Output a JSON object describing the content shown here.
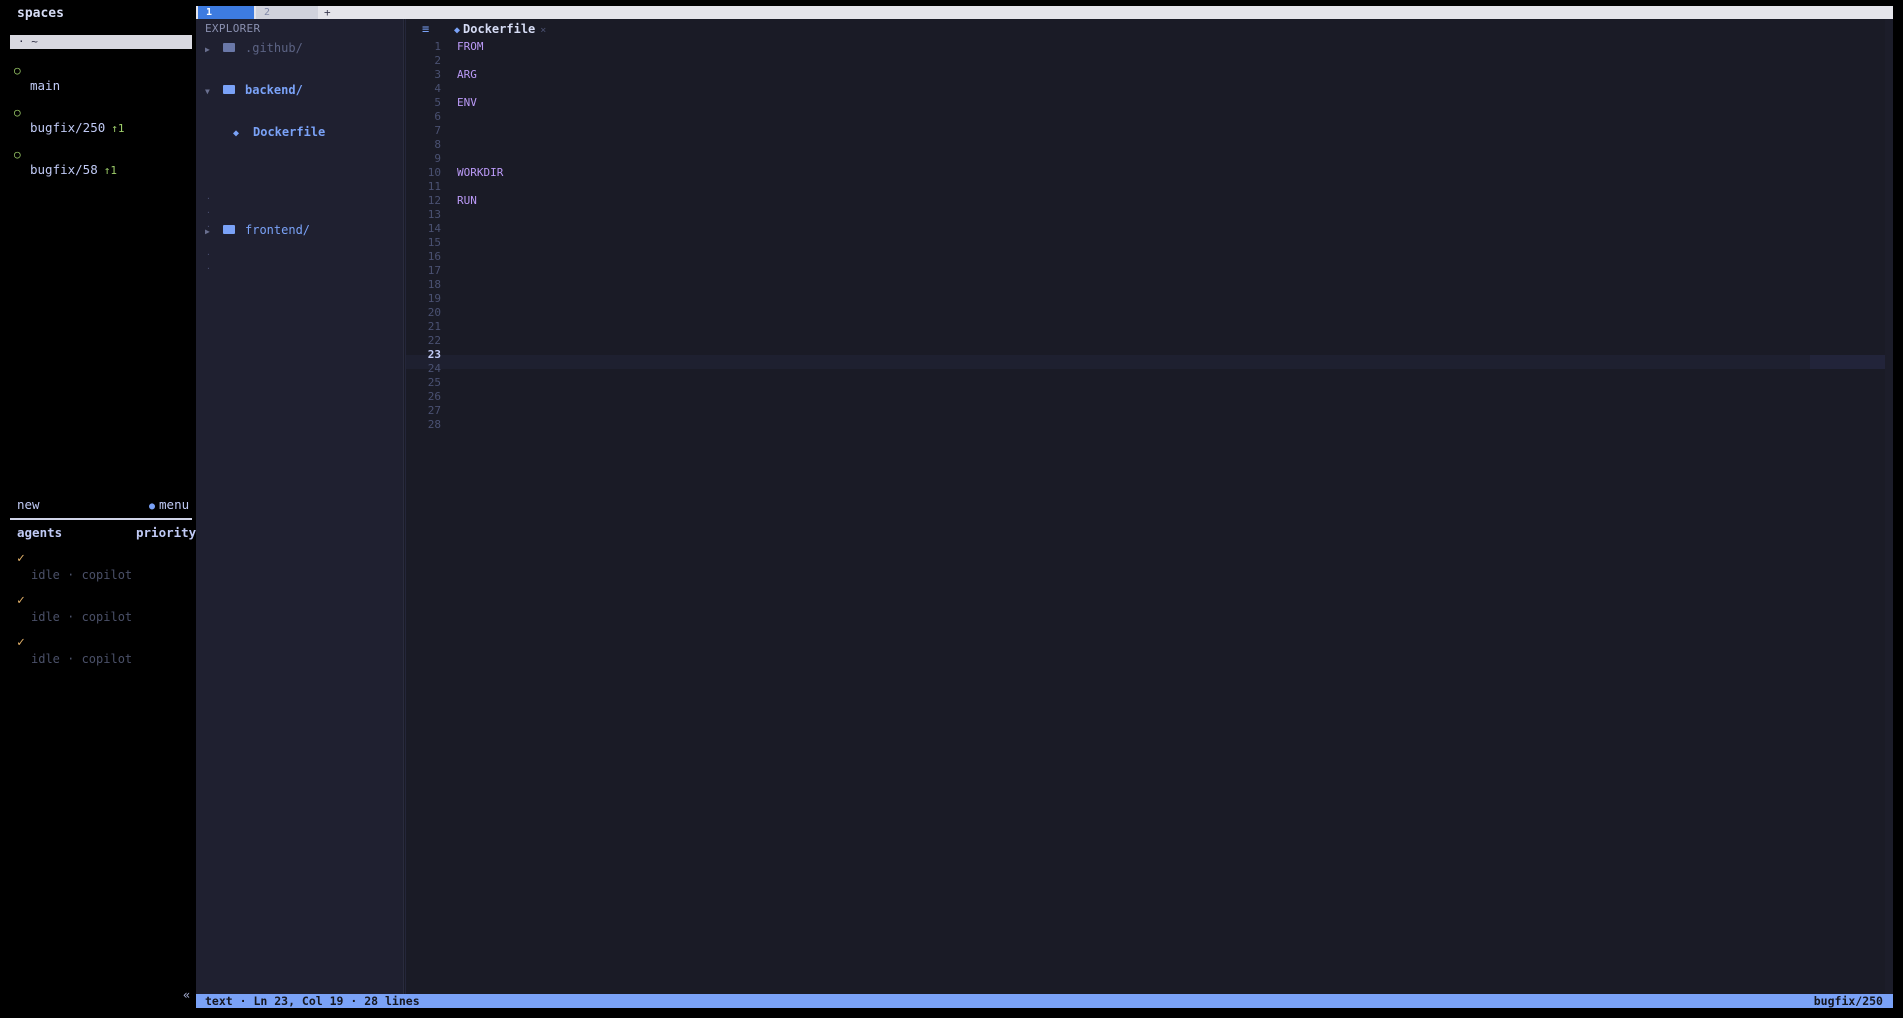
{
  "sidebar": {
    "title": "spaces",
    "home": "· ~",
    "spaces": [
      {
        "circle": "○",
        "name": "main",
        "ahead": ""
      },
      {
        "circle": "○",
        "name": "bugfix/250",
        "ahead": "↑1"
      },
      {
        "circle": "○",
        "name": "bugfix/58",
        "ahead": "↑1"
      }
    ],
    "new_label": "new",
    "menu_label": "menu",
    "agents_header": "agents",
    "priority_header": "priority",
    "agents": [
      {
        "check": "✓",
        "status": "idle · copilot"
      },
      {
        "check": "✓",
        "status": "idle · copilot"
      },
      {
        "check": "✓",
        "status": "idle · copilot"
      }
    ],
    "collapse": "«"
  },
  "tabs": {
    "active": "1",
    "inactive": "2",
    "add": "+"
  },
  "explorer": {
    "header": "EXPLORER",
    "items": [
      {
        "arrow": "▶",
        "name": ".github/"
      },
      {
        "arrow": "▼",
        "name": "backend/"
      },
      {
        "name": "Dockerfile"
      },
      {
        "arrow": "▶",
        "name": "frontend/"
      }
    ]
  },
  "editor": {
    "menu_icon": "≡",
    "file_tab": {
      "icon": "◆",
      "name": "Dockerfile",
      "close": "×"
    },
    "current_line": 23,
    "lines": [
      "1",
      "2",
      "3",
      "4",
      "5",
      "6",
      "7",
      "8",
      "9",
      "10",
      "11",
      "12",
      "13",
      "14",
      "15",
      "16",
      "17",
      "18",
      "19",
      "20",
      "21",
      "22",
      "23",
      "24",
      "25",
      "26",
      "27",
      "28"
    ],
    "code": {
      "l1": "FROM",
      "l3": "ARG",
      "l5": "ENV",
      "l10": "WORKDIR",
      "l12": "RUN"
    }
  },
  "statusbar": {
    "left": "text · Ln 23, Col 19 · 28 lines",
    "right": "bugfix/250"
  },
  "colors": {
    "accent": "#7aa2f7",
    "keyword": "#bb9af7",
    "ahead": "#9ece6a",
    "check": "#e0af68",
    "editor_bg": "#1a1b26"
  }
}
